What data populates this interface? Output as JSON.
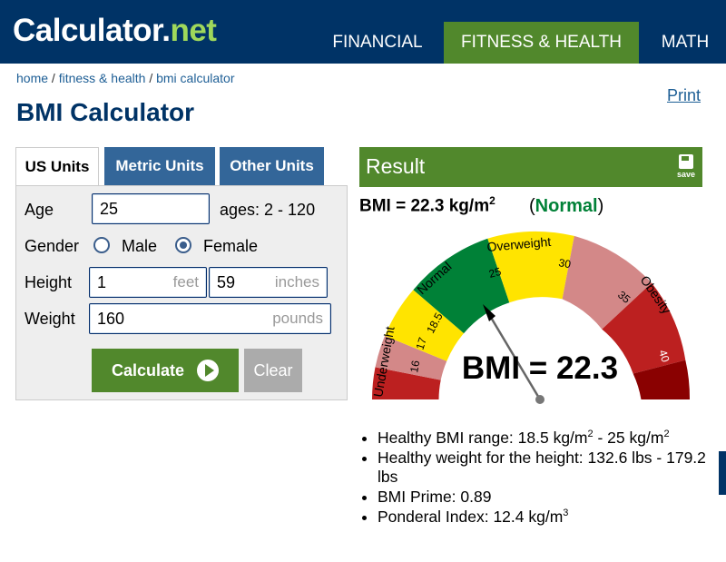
{
  "header": {
    "logo_main": "Calculator.",
    "logo_accent": "net",
    "nav": [
      "FINANCIAL",
      "FITNESS & HEALTH",
      "MATH"
    ]
  },
  "breadcrumb": {
    "home": "home",
    "fitness": "fitness & health",
    "current": "bmi calculator",
    "sep": " / "
  },
  "print_label": "Print",
  "page_title": "BMI Calculator",
  "tabs": [
    "US Units",
    "Metric Units",
    "Other Units"
  ],
  "form": {
    "age_label": "Age",
    "age_value": "25",
    "age_hint": "ages: 2 - 120",
    "gender_label": "Gender",
    "gender_male": "Male",
    "gender_female": "Female",
    "gender_selected": "Female",
    "height_label": "Height",
    "height_feet": "1",
    "height_feet_unit": "feet",
    "height_inches": "59",
    "height_inches_unit": "inches",
    "weight_label": "Weight",
    "weight_value": "160",
    "weight_unit": "pounds",
    "calculate_label": "Calculate",
    "clear_label": "Clear"
  },
  "result": {
    "title": "Result",
    "save_label": "save",
    "bmi_text": "BMI = 22.3 kg/m",
    "bmi_sup": "2",
    "status_open": "(",
    "status": "Normal",
    "status_close": ")",
    "colors": {
      "accent": "#51882c",
      "normal_text": "#008137",
      "header": "#003366"
    }
  },
  "gauge": {
    "bmi_value": 22.3,
    "bmi_label": "BMI = 22.3",
    "zone_labels": [
      "Underweight",
      "Normal",
      "Overweight",
      "Obesity"
    ],
    "tick_labels": [
      "16",
      "17",
      "18.5",
      "25",
      "30",
      "35",
      "40"
    ],
    "colors": {
      "severe_under": "#bc2020",
      "mod_under": "#d38888",
      "mild_under": "#ffe400",
      "normal": "#008137",
      "over": "#ffe400",
      "obese1": "#d38888",
      "obese2": "#bc2020",
      "obese3": "#8a0101"
    }
  },
  "stats": {
    "range_text": "Healthy BMI range: 18.5 kg/m",
    "range_sup1": "2",
    "range_mid": " - 25 kg/m",
    "range_sup2": "2",
    "weight_text": "Healthy weight for the height: 132.6 lbs - 179.2 lbs",
    "prime_text": "BMI Prime: 0.89",
    "ponderal_text": "Ponderal Index: 12.4 kg/m",
    "ponderal_sup": "3"
  }
}
